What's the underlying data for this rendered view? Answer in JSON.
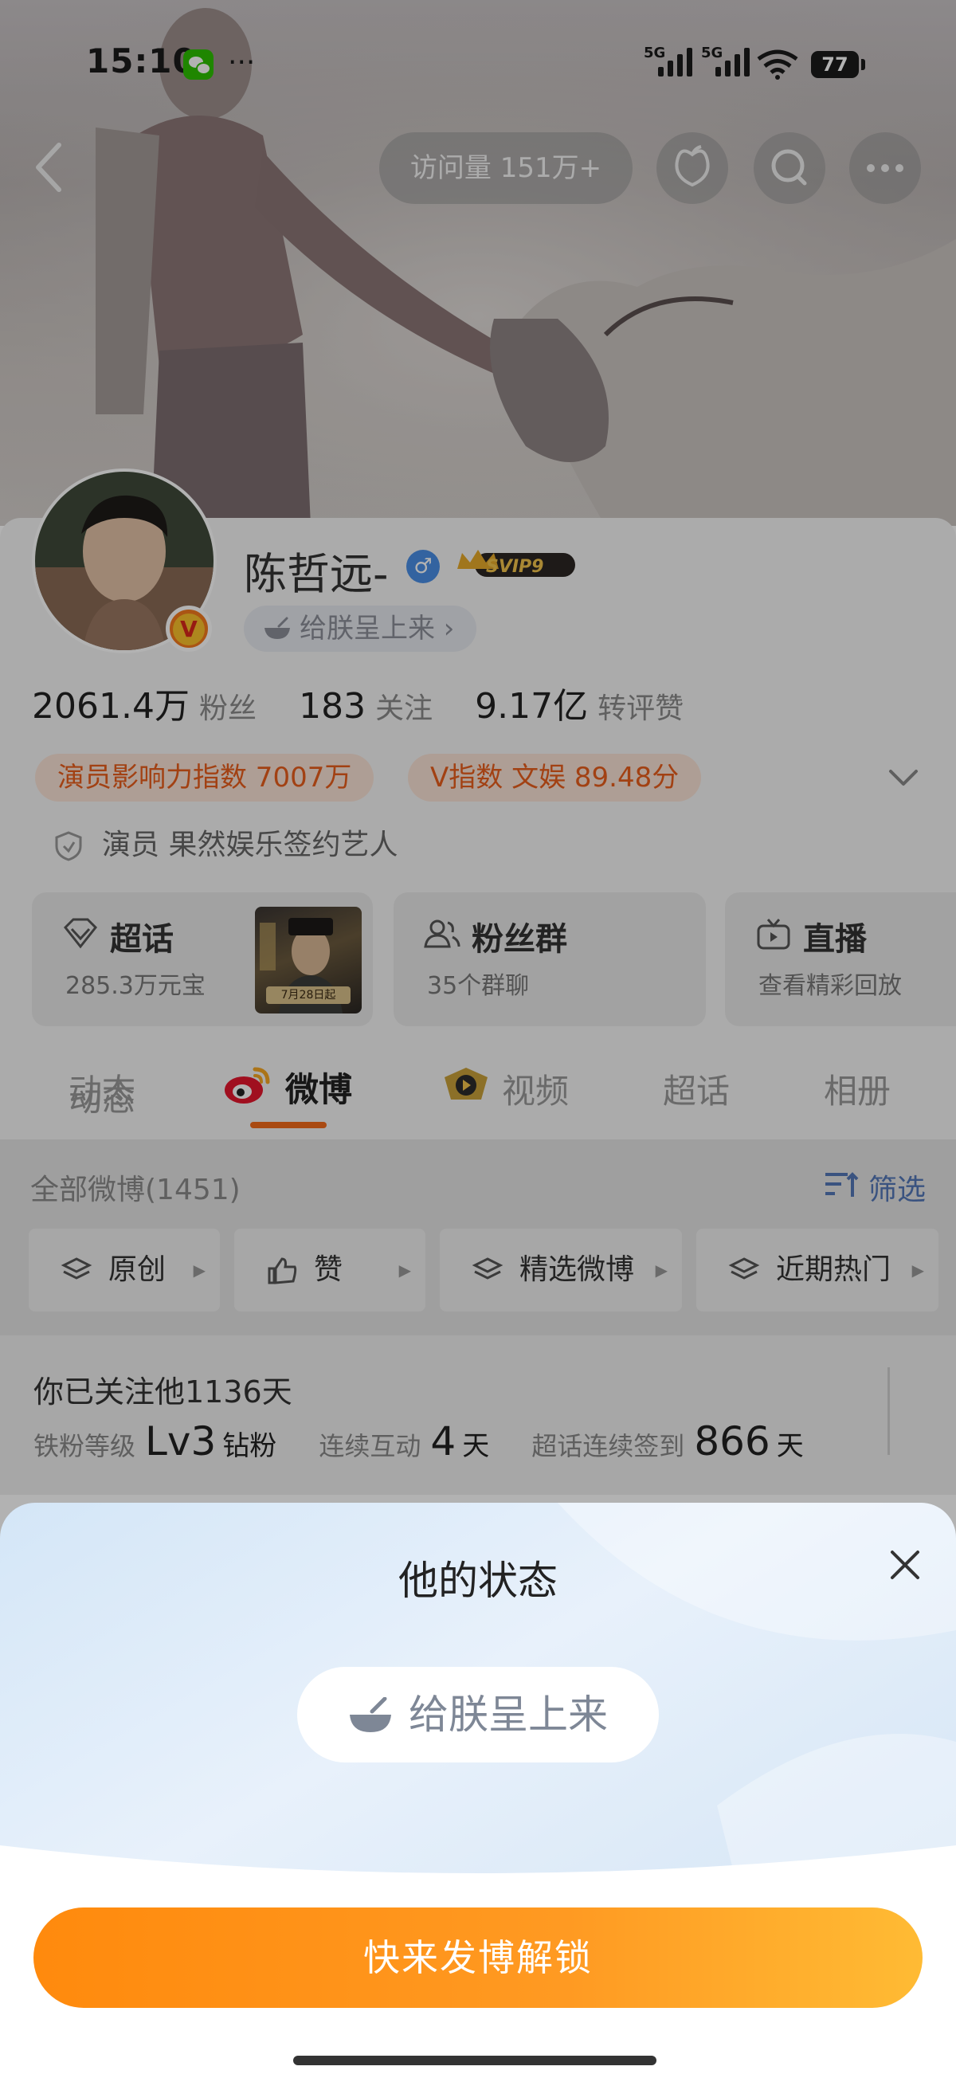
{
  "status_bar": {
    "time": "15:10",
    "more": "···",
    "sig1": "5G",
    "sig2": "5G",
    "battery": "77"
  },
  "top_bar": {
    "visits": "访问量 151万+"
  },
  "profile": {
    "name": "陈哲远-",
    "gender_symbol": "♂",
    "vip_label": "SVIP9",
    "status_chip": "给朕呈上来 ›",
    "stats": [
      {
        "num": "2061.4万",
        "label": "粉丝"
      },
      {
        "num": "183",
        "label": "关注"
      },
      {
        "num": "9.17亿",
        "label": "转评赞"
      }
    ],
    "tags": [
      "演员影响力指数 7007万",
      "V指数 文娱 89.48分"
    ],
    "cert": "演员 果然娱乐签约艺人"
  },
  "feature_cards": [
    {
      "title": "超话",
      "sub": "285.3万元宝"
    },
    {
      "title": "粉丝群",
      "sub": "35个群聊"
    },
    {
      "title": "直播",
      "sub": "查看精彩回放"
    }
  ],
  "poster_date": "7月28日起",
  "tabs": [
    "动态",
    "微博",
    "视频",
    "超话",
    "相册"
  ],
  "feed": {
    "count": "全部微博(1451)",
    "filter": "筛选",
    "filters": [
      "原创",
      "赞",
      "精选微博",
      "近期热门"
    ]
  },
  "fan": {
    "followed": "你已关注他1136天",
    "items": [
      {
        "k": "铁粉等级",
        "v": "Lv3",
        "u": "钻粉"
      },
      {
        "k": "连续互动",
        "v": "4",
        "u": "天"
      },
      {
        "k": "超话连续签到",
        "v": "866",
        "u": "天"
      }
    ]
  },
  "sheet": {
    "title": "他的状态",
    "status": "给朕呈上来",
    "cta": "快来发博解锁"
  },
  "colors": {
    "accent": "#ff8a0d",
    "tag_text": "#e85d1c",
    "filter_blue": "#5478b8"
  }
}
